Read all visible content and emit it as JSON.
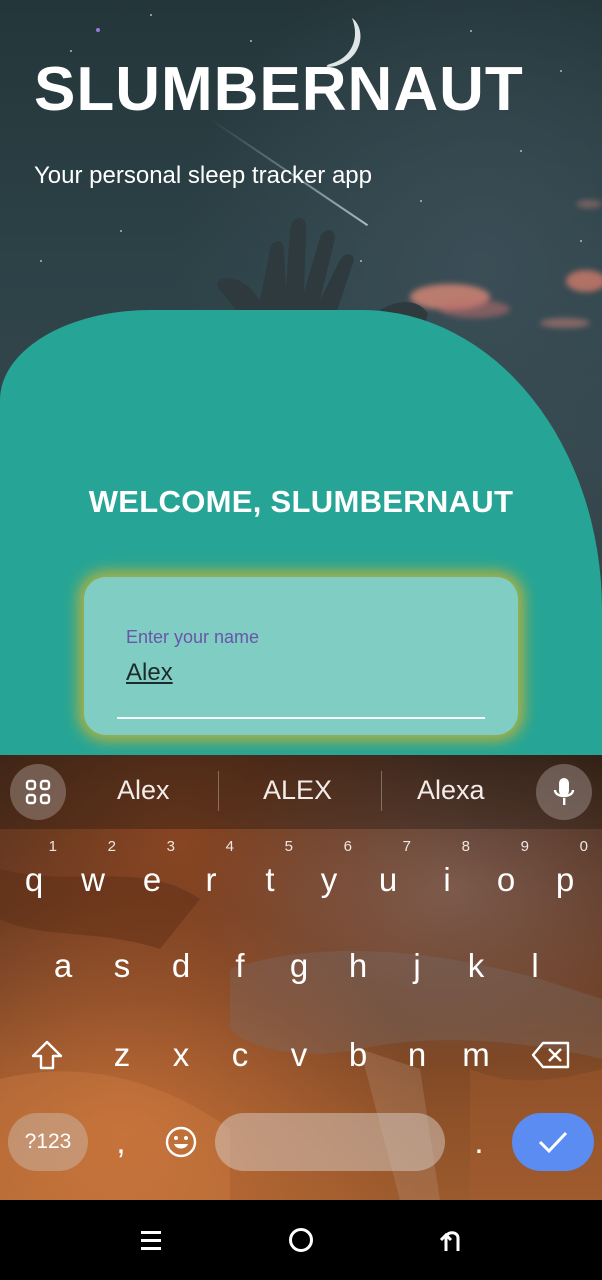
{
  "app": {
    "title": "SLUMBERNAUT",
    "subtitle": "Your personal sleep tracker app"
  },
  "welcome": {
    "heading": "WELCOME, SLUMBERNAUT"
  },
  "name_field": {
    "label": "Enter your name",
    "value": "Alex"
  },
  "keyboard": {
    "suggestions": [
      "Alex",
      "ALEX",
      "Alexa"
    ],
    "row1": [
      {
        "key": "q",
        "hint": "1"
      },
      {
        "key": "w",
        "hint": "2"
      },
      {
        "key": "e",
        "hint": "3"
      },
      {
        "key": "r",
        "hint": "4"
      },
      {
        "key": "t",
        "hint": "5"
      },
      {
        "key": "y",
        "hint": "6"
      },
      {
        "key": "u",
        "hint": "7"
      },
      {
        "key": "i",
        "hint": "8"
      },
      {
        "key": "o",
        "hint": "9"
      },
      {
        "key": "p",
        "hint": "0"
      }
    ],
    "row2": [
      "a",
      "s",
      "d",
      "f",
      "g",
      "h",
      "j",
      "k",
      "l"
    ],
    "row3": [
      "z",
      "x",
      "c",
      "v",
      "b",
      "n",
      "m"
    ],
    "symbols_label": "?123",
    "comma": ",",
    "period": ".",
    "icons": {
      "apps": "grid-icon",
      "mic": "microphone-icon",
      "shift": "shift-icon",
      "backspace": "backspace-icon",
      "emoji": "emoji-icon",
      "enter": "checkmark-icon"
    },
    "enter_color": "#5b8cf2"
  },
  "colors": {
    "card": "#26a596",
    "name_box": "#80cdc3",
    "name_label": "#6a55a8",
    "glow": "#dcb428"
  },
  "navbar": {
    "icons": [
      "menu-icon",
      "home-icon",
      "back-icon"
    ]
  }
}
